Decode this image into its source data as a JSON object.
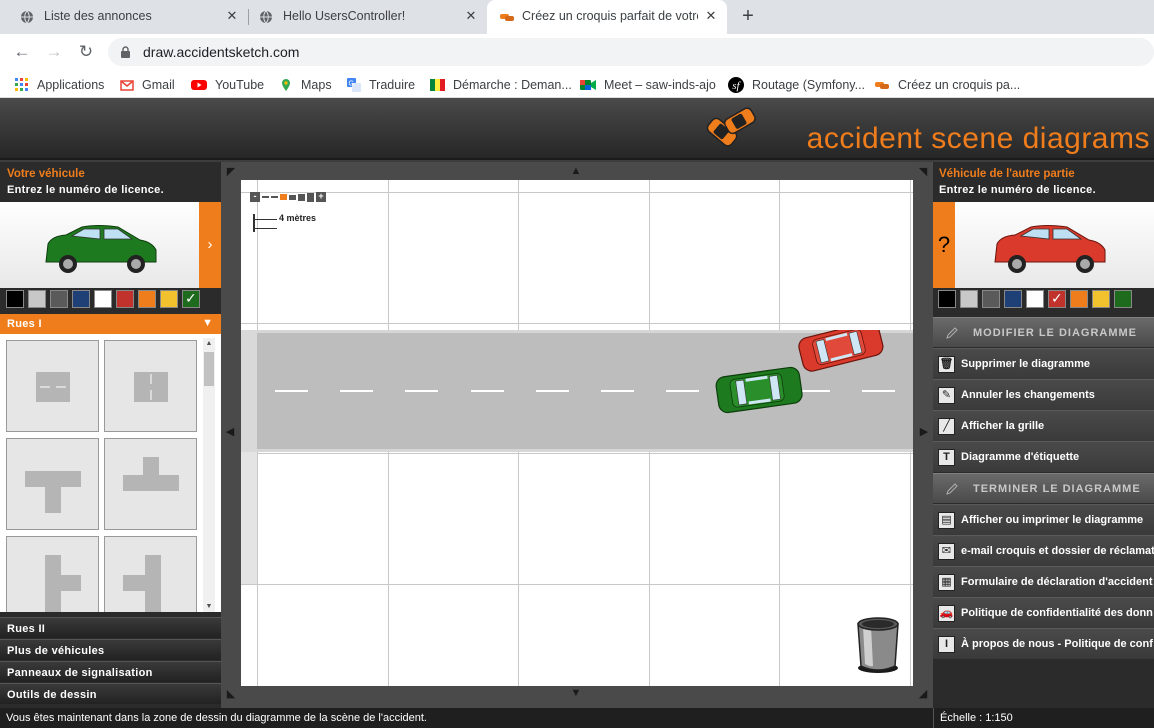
{
  "browser": {
    "tabs": [
      {
        "label": "Liste des annonces",
        "icon": "globe-icon"
      },
      {
        "label": "Hello UsersController!",
        "icon": "globe-icon"
      },
      {
        "label": "Créez un croquis parfait de votre",
        "icon": "cars-icon",
        "active": true
      }
    ],
    "url": "draw.accidentsketch.com",
    "bookmarks": [
      {
        "label": "Applications",
        "icon": "apps-grid-icon"
      },
      {
        "label": "Gmail",
        "icon": "gmail-icon"
      },
      {
        "label": "YouTube",
        "icon": "youtube-icon"
      },
      {
        "label": "Maps",
        "icon": "maps-pin-icon"
      },
      {
        "label": "Traduire",
        "icon": "translate-icon"
      },
      {
        "label": "Démarche : Deman...",
        "icon": "flag-icon"
      },
      {
        "label": "Meet – saw-inds-ajo",
        "icon": "meet-icon"
      },
      {
        "label": "Routage (Symfony...",
        "icon": "symfony-icon"
      },
      {
        "label": "Créez un croquis pa...",
        "icon": "cars-icon"
      }
    ]
  },
  "app": {
    "brand": "accident scene diagrams",
    "left_panel": {
      "title": "Votre véhicule",
      "subtitle": "Entrez le numéro de licence.",
      "toggle": "›",
      "swatches": [
        "#000000",
        "#c8c8c8",
        "#5a5a5a",
        "#1f3f77",
        "#ffffff",
        "#c0322b",
        "#f07d1c",
        "#f2c12e",
        "#1e6b1e"
      ],
      "selected_swatch": 8,
      "car_color": "#1e7a1e",
      "categories": {
        "open": "Rues I",
        "others": [
          "Rues II",
          "Plus de véhicules",
          "Panneaux de signalisation",
          "Outils de dessin"
        ]
      }
    },
    "canvas": {
      "scale_label": "4 mètres",
      "zoom_minus": "-",
      "zoom_plus": "+"
    },
    "right_panel": {
      "title": "Véhicule de l'autre partie",
      "subtitle": "Entrez le numéro de licence.",
      "toggle": "?",
      "swatches": [
        "#000000",
        "#c8c8c8",
        "#5a5a5a",
        "#1f3f77",
        "#ffffff",
        "#c0322b",
        "#f07d1c",
        "#f2c12e",
        "#1e6b1e"
      ],
      "selected_swatch": 5,
      "car_color": "#d93a2b",
      "modify_header": "MODIFIER LE DIAGRAMME",
      "modify_actions": [
        {
          "label": "Supprimer le diagramme",
          "icon": "trash-icon",
          "glyph": "🗑"
        },
        {
          "label": "Annuler les changements",
          "icon": "undo-icon",
          "glyph": "✎"
        },
        {
          "label": "Afficher la grille",
          "icon": "grid-icon",
          "glyph": "╱"
        },
        {
          "label": "Diagramme d'étiquette",
          "icon": "text-label-icon",
          "glyph": "T"
        }
      ],
      "finish_header": "TERMINER LE DIAGRAMME",
      "finish_actions": [
        {
          "label": "Afficher ou imprimer le diagramme",
          "icon": "print-icon",
          "glyph": "▤"
        },
        {
          "label": "e-mail croquis et dossier de réclamat",
          "icon": "email-icon",
          "glyph": "✉"
        },
        {
          "label": "Formulaire de déclaration d'accident",
          "icon": "form-icon",
          "glyph": "▦"
        },
        {
          "label": "Politique de confidentialité des donn",
          "icon": "car-policy-icon",
          "glyph": "🚗"
        },
        {
          "label": "À propos de nous - Politique de conf",
          "icon": "info-icon",
          "glyph": "I"
        }
      ]
    },
    "status": "Vous êtes maintenant dans la zone de dessin du diagramme de la scène de l'accident.",
    "scale": "Échelle : 1:150"
  }
}
